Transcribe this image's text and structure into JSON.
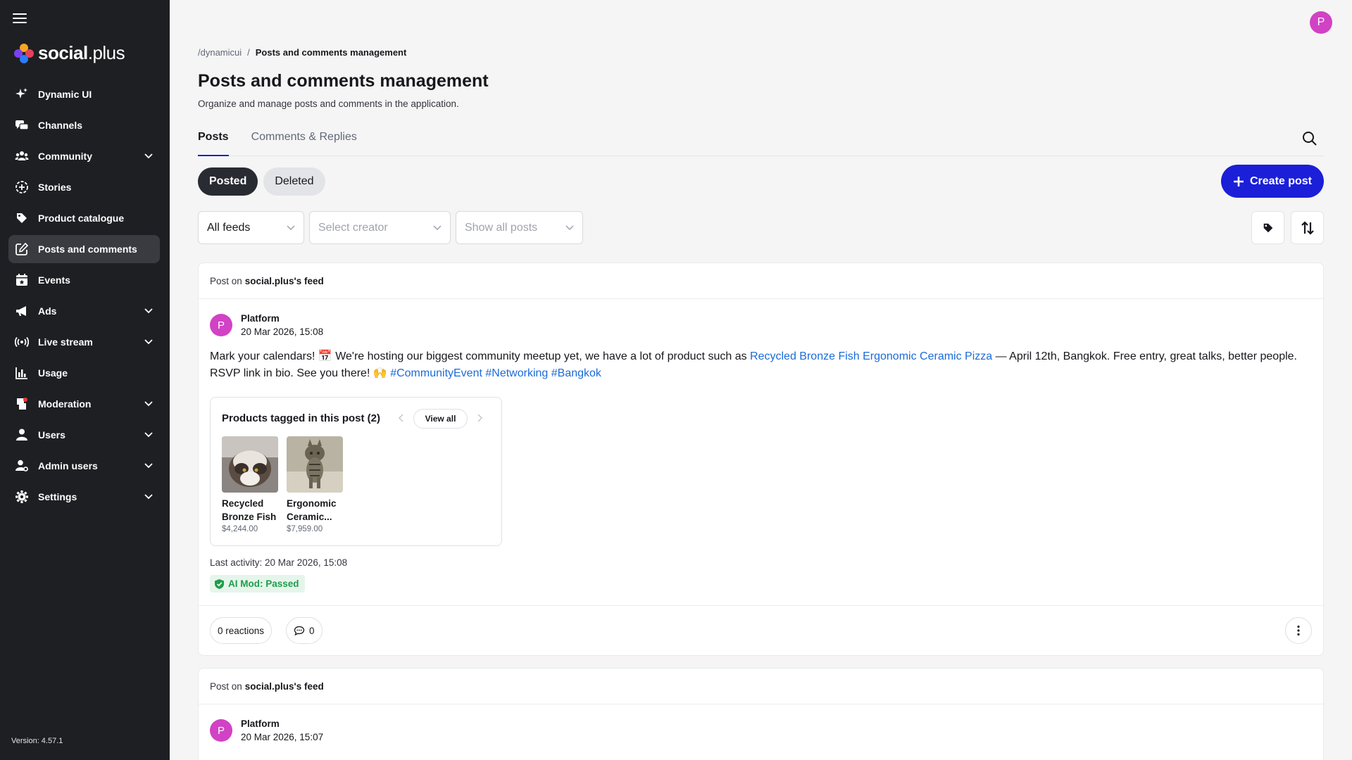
{
  "app": {
    "logo_text_bold": "social",
    "logo_text_light": ".plus",
    "version": "Version: 4.57.1",
    "user_initial": "P"
  },
  "sidebar": {
    "items": [
      {
        "label": "Dynamic UI",
        "icon": "sparkles-icon"
      },
      {
        "label": "Channels",
        "icon": "chat-bubbles-icon"
      },
      {
        "label": "Community",
        "icon": "people-icon"
      },
      {
        "label": "Stories",
        "icon": "stories-icon"
      },
      {
        "label": "Product catalogue",
        "icon": "tag-icon"
      },
      {
        "label": "Posts and comments",
        "icon": "edit-icon"
      },
      {
        "label": "Events",
        "icon": "calendar-icon"
      },
      {
        "label": "Ads",
        "icon": "megaphone-icon"
      },
      {
        "label": "Live stream",
        "icon": "broadcast-icon"
      },
      {
        "label": "Usage",
        "icon": "bar-chart-icon"
      },
      {
        "label": "Moderation",
        "icon": "moderation-icon"
      },
      {
        "label": "Users",
        "icon": "user-icon"
      },
      {
        "label": "Admin users",
        "icon": "admin-user-icon"
      },
      {
        "label": "Settings",
        "icon": "gear-icon"
      }
    ]
  },
  "header": {
    "breadcrumb_root": "/dynamicui",
    "breadcrumb_sep": "/",
    "breadcrumb_current": "Posts and comments management",
    "title": "Posts and comments management",
    "subtitle": "Organize and manage posts and comments in the application."
  },
  "tabs": [
    {
      "label": "Posts"
    },
    {
      "label": "Comments & Replies"
    }
  ],
  "filters": {
    "posted": "Posted",
    "deleted": "Deleted",
    "create_post": "Create post",
    "feed_value": "All feeds",
    "creator_placeholder": "Select creator",
    "posts_placeholder": "Show all posts"
  },
  "posts": [
    {
      "head_prefix": "Post on",
      "head_feed": "social.plus's feed",
      "author": "Platform",
      "author_initial": "P",
      "time": "20 Mar 2026, 15:08",
      "text_1": "Mark your calendars! 📅 We're hosting our biggest community meetup yet, we have a lot of product such as ",
      "text_link": "Recycled Bronze Fish Ergonomic Ceramic Pizza",
      "text_2": " — April 12th, Bangkok. Free entry, great talks, better people. RSVP link in bio. See you there! 🙌 ",
      "hashtags": "#CommunityEvent #Networking #Bangkok",
      "products_title": "Products tagged in this post (2)",
      "view_all": "View all",
      "products": [
        {
          "name": "Recycled Bronze Fish",
          "price": "$4,244.00"
        },
        {
          "name": "Ergonomic Ceramic...",
          "price": "$7,959.00"
        }
      ],
      "last_activity": "Last activity: 20 Mar 2026, 15:08",
      "ai_mod": "AI Mod: Passed",
      "reactions": "0 reactions",
      "comments": "0"
    },
    {
      "head_prefix": "Post on",
      "head_feed": "social.plus's feed",
      "author": "Platform",
      "author_initial": "P",
      "time": "20 Mar 2026, 15:07"
    }
  ]
}
